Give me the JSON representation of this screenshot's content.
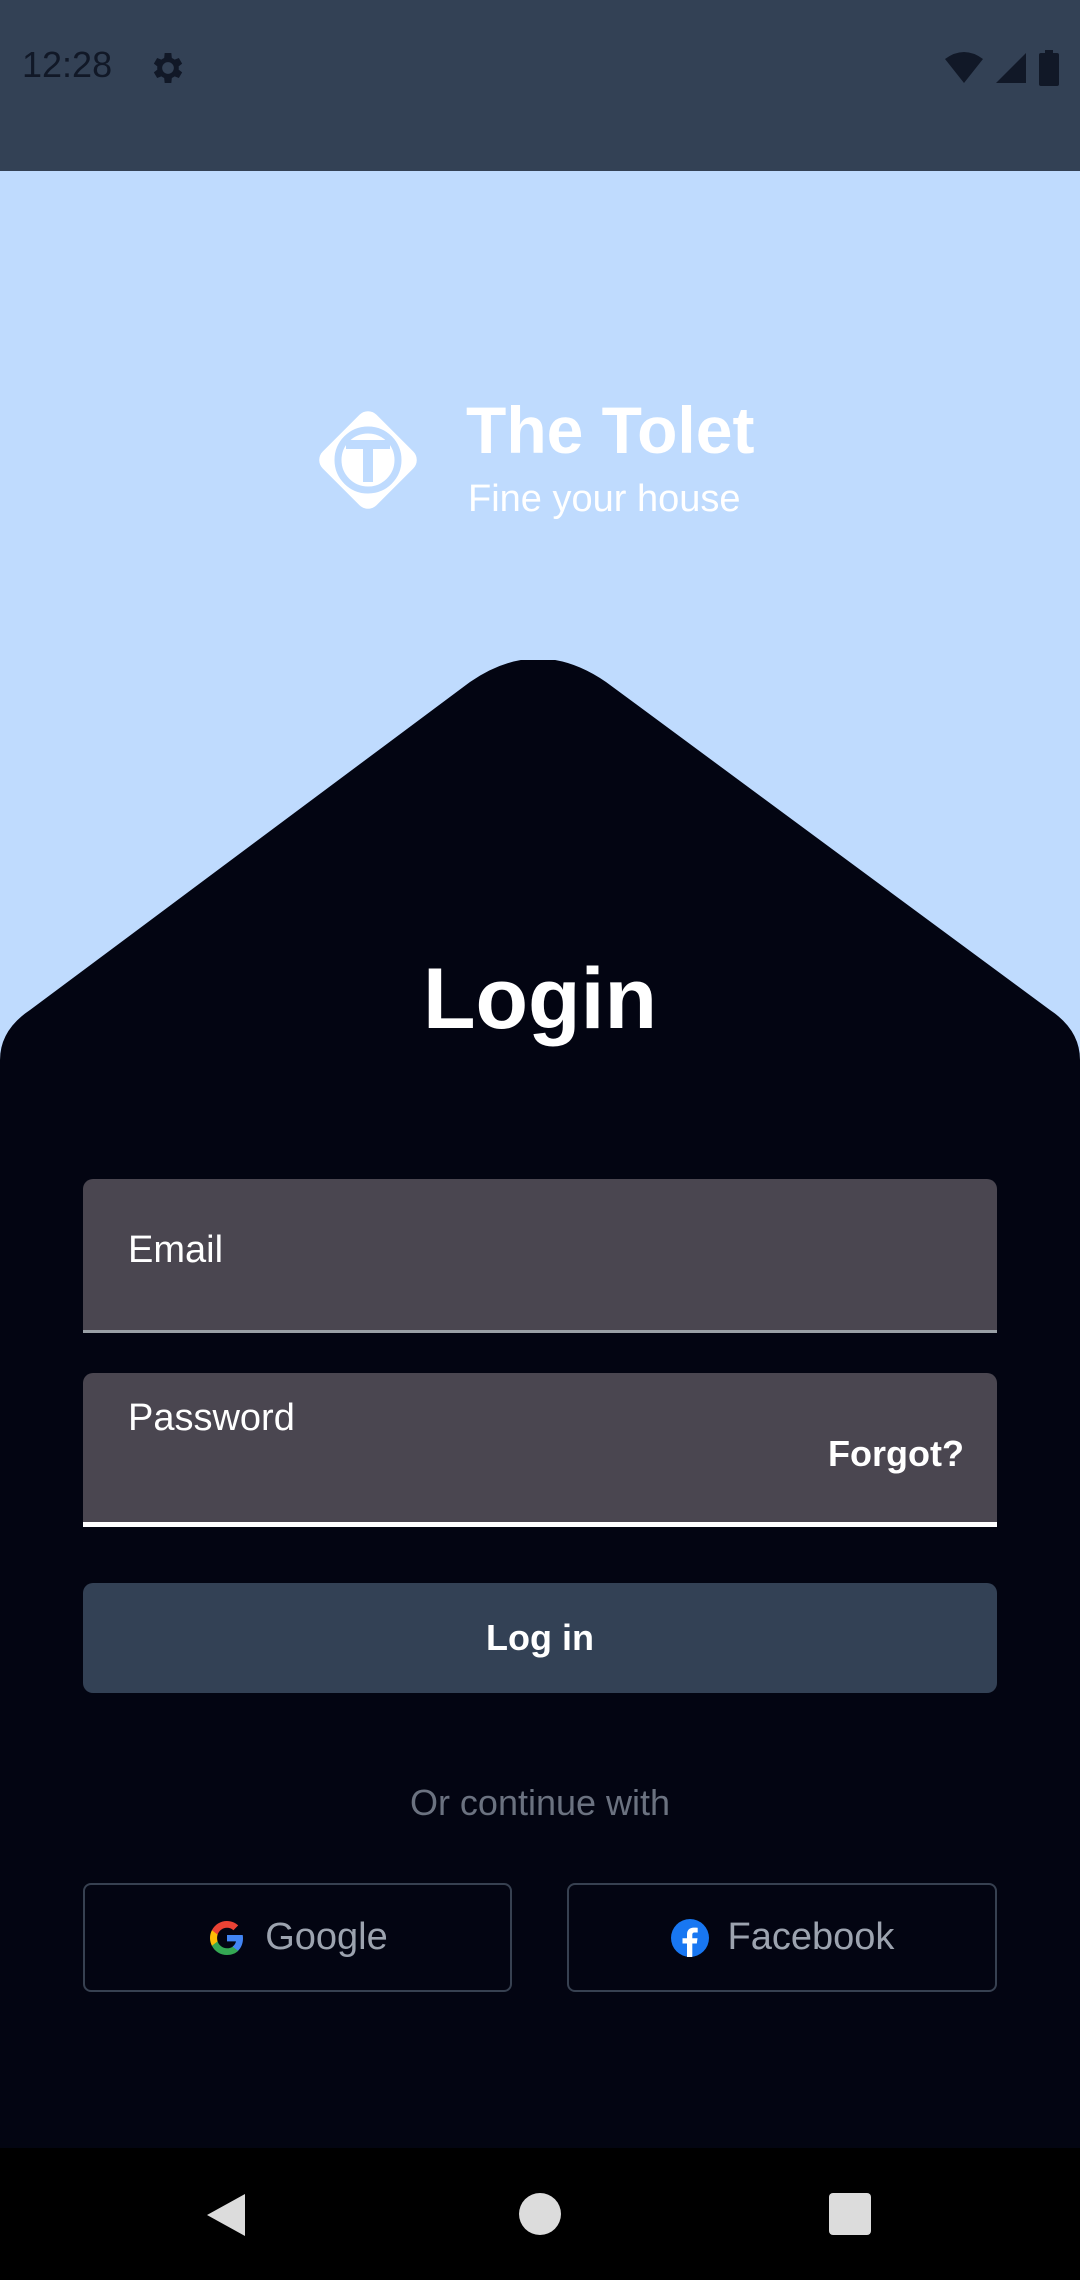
{
  "status_bar": {
    "time": "12:28"
  },
  "brand": {
    "title": "The Tolet",
    "subtitle": "Fine your house"
  },
  "login": {
    "title": "Login",
    "email_label": "Email",
    "password_label": "Password",
    "forgot_label": "Forgot?",
    "submit_label": "Log in",
    "or_text": "Or continue with",
    "google_label": "Google",
    "facebook_label": "Facebook"
  },
  "colors": {
    "background": "#bfdbfe",
    "panel": "#030512",
    "status_bar": "#334155",
    "field": "#4a4650",
    "button": "#334155"
  },
  "icons": {
    "status": [
      "gear-icon",
      "wifi-icon",
      "signal-icon",
      "battery-icon"
    ],
    "logo": "tolet-logo-icon",
    "social": [
      "google-icon",
      "facebook-icon"
    ],
    "navigation": [
      "back-icon",
      "home-icon",
      "recents-icon"
    ]
  }
}
